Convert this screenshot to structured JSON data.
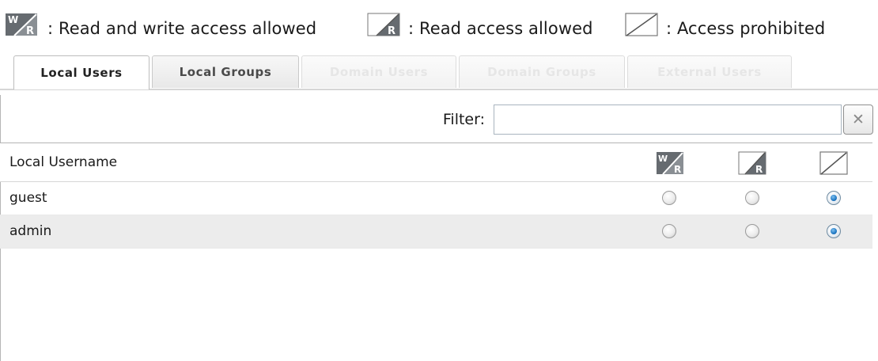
{
  "legend": {
    "items": [
      {
        "icon": "read-write-icon",
        "text": ": Read and write access allowed"
      },
      {
        "icon": "read-only-icon",
        "text": ": Read access allowed"
      },
      {
        "icon": "access-prohibited-icon",
        "text": ": Access prohibited"
      }
    ]
  },
  "tabs": [
    {
      "label": "Local Users",
      "state": "active"
    },
    {
      "label": "Local Groups",
      "state": "normal"
    },
    {
      "label": "Domain Users",
      "state": "disabled"
    },
    {
      "label": "Domain Groups",
      "state": "disabled"
    },
    {
      "label": "External Users",
      "state": "disabled"
    }
  ],
  "filter": {
    "label": "Filter:",
    "value": "",
    "placeholder": "",
    "clear_symbol": "✕"
  },
  "grid": {
    "column_username": "Local Username",
    "columns": [
      "read-write-icon",
      "read-only-icon",
      "access-prohibited-icon"
    ],
    "rows": [
      {
        "name": "guest",
        "selected": "access-prohibited"
      },
      {
        "name": "admin",
        "selected": "access-prohibited"
      }
    ]
  },
  "icon_labels": {
    "write": "W",
    "read": "R"
  },
  "colors": {
    "radio_selected": "#1f78c4",
    "icon_dark": "#5f6469",
    "alt_row": "#ececec"
  }
}
